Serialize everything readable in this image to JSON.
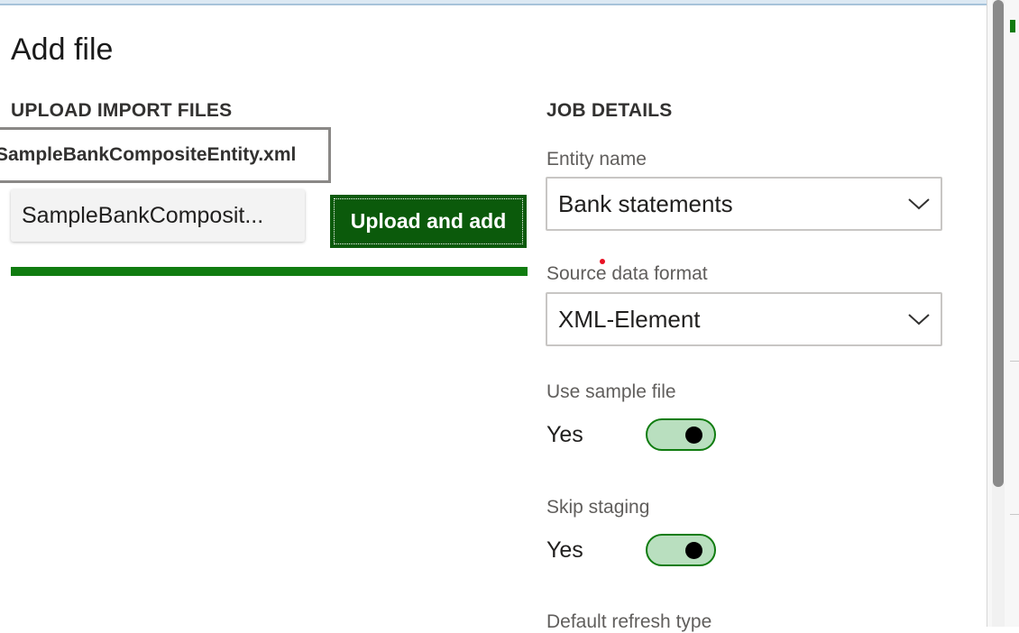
{
  "dialog": {
    "title": "Add file"
  },
  "upload": {
    "section_title": "UPLOAD IMPORT FILES",
    "selected_file_name": "SampleBankCompositeEntity.xml",
    "file_pill_label": "SampleBankComposit...",
    "upload_button_label": "Upload and add",
    "progress": 1.0
  },
  "job_details": {
    "section_title": "JOB DETAILS",
    "entity_name_label": "Entity name",
    "entity_name_value": "Bank statements",
    "source_format_label": "Source data format",
    "source_format_value": "XML-Element",
    "use_sample_label": "Use sample file",
    "use_sample_value": "Yes",
    "use_sample_on": true,
    "skip_staging_label": "Skip staging",
    "skip_staging_value": "Yes",
    "skip_staging_on": true,
    "default_refresh_label": "Default refresh type"
  },
  "colors": {
    "accent_green": "#107c10",
    "button_green": "#0b5a0b",
    "toggle_fill": "#b9dfbf"
  },
  "icons": {
    "dropdown": "chevron-down-icon",
    "toggle_knob": "toggle-knob-icon"
  }
}
